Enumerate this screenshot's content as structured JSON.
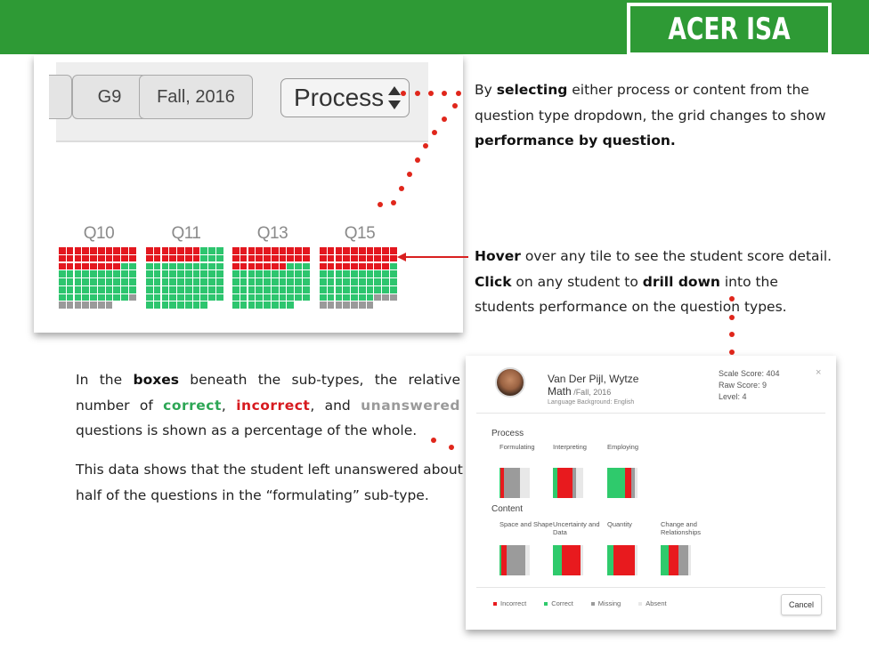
{
  "brand": {
    "title": "ACER ISA"
  },
  "toolbar": {
    "grade_label": "G9",
    "term_label": "Fall, 2016",
    "question_type_value": "Process"
  },
  "questions": [
    {
      "label": "Q10",
      "rows": [
        "rrrrrrrrrr",
        "rrrrrrrrrr",
        "rrrrrrrrgg",
        "ggggggggg g",
        "gggggggggg",
        "gggggggggg",
        "gggggggggn",
        "nnnnnnn"
      ]
    },
    {
      "label": "Q11",
      "rows": [
        "rrrrrrrggg",
        "rrrrrrrggg",
        "gggggggggg",
        "gggggggggg",
        "gggggggggg",
        "gggggggggg",
        "gggggggggg",
        "gggggggg"
      ]
    },
    {
      "label": "Q13",
      "rows": [
        "rrrrrrrrrr",
        "rrrrrrrrrr",
        "rrrrrrrggg",
        "gggggggggg",
        "gggggggggg",
        "gggggggggg",
        "gggggggggg",
        "gggggggg"
      ]
    },
    {
      "label": "Q15",
      "rows": [
        "rrrrrrrrrr",
        "rrrrrrrrrr",
        "rrrrrrrrrg",
        "gggggggggg",
        "gggggggggg",
        "gggggggggg",
        "gggggggnnn",
        "nnnnnnn"
      ]
    }
  ],
  "callouts": {
    "select_pre": "By ",
    "select_bold": "selecting",
    "select_mid": " either process or content from the question type dropdown, the grid changes to show ",
    "select_bold2": "performance by question.",
    "hover_bold": "Hover",
    "hover_text": " over any tile to see the student score detail.",
    "click_bold": "Click",
    "click_mid": " on any student to ",
    "drill_bold": "drill down",
    "click_end": " into the students performance on the question types.",
    "boxes_pre": "In the ",
    "boxes_bold": "boxes",
    "boxes_mid": " beneath the sub-types, the relative number of ",
    "correct_word": "correct",
    "comma1": ", ",
    "incorrect_word": "incorrect",
    "and_text": ", and ",
    "unanswered_word": "unanswered",
    "boxes_end": " questions is shown as a percentage of the whole.",
    "data_text": "This data shows that the student left unanswered about half of the questions in the “formulating” sub-type."
  },
  "student_card": {
    "name_line1": "Van Der Pijl, Wytze",
    "name_line2": "Math",
    "term": " /Fall, 2016",
    "language": "Language Background: English",
    "scale_score": "Scale Score: 404",
    "raw_score": "Raw Score: 9",
    "level": "Level: 4",
    "close": "×",
    "process_label": "Process",
    "content_label": "Content",
    "process_items": [
      {
        "label": "Formulating",
        "incorrect": 0.12,
        "correct": 0.04,
        "missing": 0.52
      },
      {
        "label": "Interpreting",
        "incorrect": 0.5,
        "correct": 0.15,
        "missing": 0.12
      },
      {
        "label": "Employing",
        "incorrect": 0.22,
        "correct": 0.58,
        "missing": 0.1
      }
    ],
    "content_items": [
      {
        "label": "Space and Shape",
        "incorrect": 0.2,
        "correct": 0.05,
        "missing": 0.6
      },
      {
        "label": "Uncertainty and Data",
        "incorrect": 0.6,
        "correct": 0.3,
        "missing": 0
      },
      {
        "label": "Quantity",
        "incorrect": 0.72,
        "correct": 0.2,
        "missing": 0
      },
      {
        "label": "Change and Relationships",
        "incorrect": 0.35,
        "correct": 0.25,
        "missing": 0.3
      }
    ],
    "legend": [
      "Incorrect",
      "Correct",
      "Missing",
      "Absent"
    ],
    "cancel_label": "Cancel",
    "colors": {
      "incorrect": "#e81a1e",
      "correct": "#2fca6c",
      "missing": "#9b9b9b",
      "absent": "#e8e8e8"
    }
  }
}
